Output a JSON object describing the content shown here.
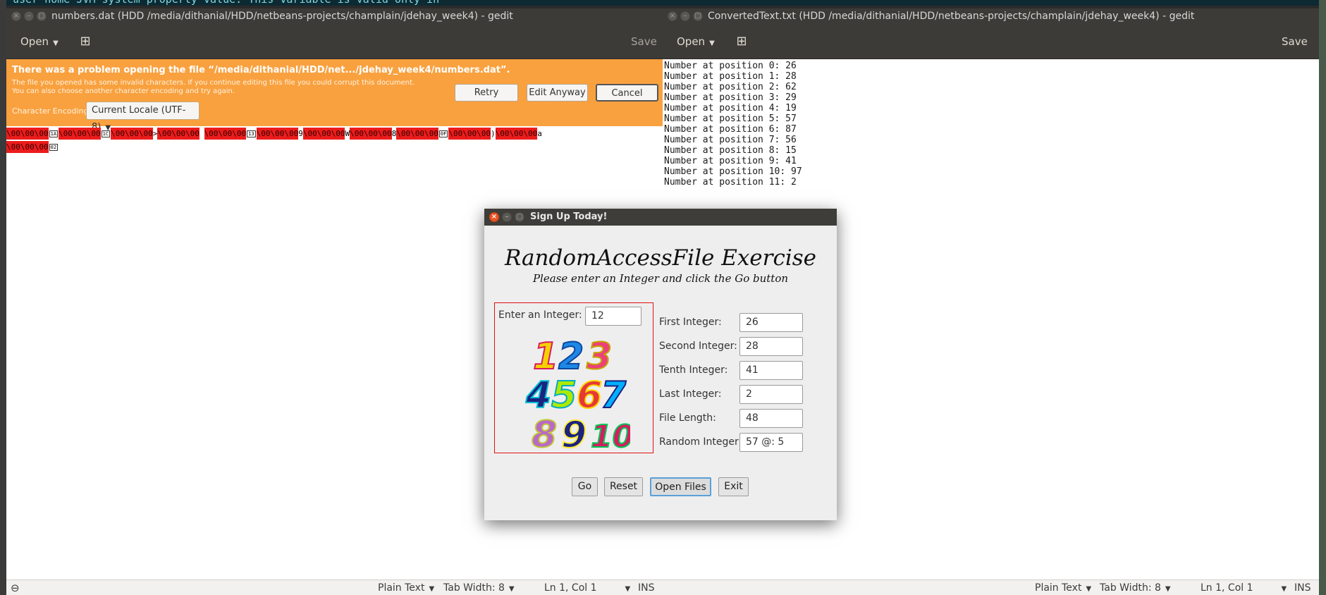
{
  "background_terminal": {
    "text": "# user home JVM system property value. This variable is valid only in"
  },
  "left_window": {
    "title": "numbers.dat (HDD /media/dithanial/HDD/netbeans-projects/champlain/jdehay_week4) - gedit",
    "toolbar": {
      "open_label": "Open",
      "new_tab_icon": "new-document-icon",
      "save_label": "Save"
    },
    "infobar": {
      "title": "There was a problem opening the file “/media/dithanial/HDD/net.../jdehay_week4/numbers.dat”.",
      "line1": "The file you opened has some invalid characters. If you continue editing this file you could corrupt this document.",
      "line2": "You can also choose another character encoding and try again.",
      "encoding_label": "Character Encoding:",
      "encoding_value": "Current Locale (UTF-8)",
      "retry_label": "Retry",
      "edit_anyway_label": "Edit Anyway",
      "cancel_label": "Cancel"
    },
    "content": {
      "line1": [
        {
          "t": "\\00\\00\\00",
          "bad": true
        },
        {
          "t": "1A",
          "box": true
        },
        {
          "t": "\\00\\00\\00",
          "bad": true
        },
        {
          "t": "1C",
          "box": true
        },
        {
          "t": "\\00\\00\\00",
          "bad": true
        },
        {
          "t": ">",
          "bad": false
        },
        {
          "t": "\\00\\00\\00",
          "bad": true
        },
        {
          "t": " ",
          "bad": false
        },
        {
          "t": "\\00\\00\\00",
          "bad": true
        },
        {
          "t": "13",
          "box": true
        },
        {
          "t": "\\00\\00\\00",
          "bad": true
        },
        {
          "t": "9",
          "bad": false
        },
        {
          "t": "\\00\\00\\00",
          "bad": true
        },
        {
          "t": "W",
          "bad": false
        },
        {
          "t": "\\00\\00\\00",
          "bad": true
        },
        {
          "t": "8",
          "bad": false
        },
        {
          "t": "\\00\\00\\00",
          "bad": true
        },
        {
          "t": "0F",
          "box": true
        },
        {
          "t": "\\00\\00\\00",
          "bad": true
        },
        {
          "t": ")",
          "bad": false
        },
        {
          "t": "\\00\\00\\00",
          "bad": true
        },
        {
          "t": "a",
          "bad": false
        }
      ],
      "line2": [
        {
          "t": "\\00\\00\\00",
          "bad": true
        },
        {
          "t": "02",
          "box": true
        }
      ]
    },
    "statusbar": {
      "syntax": "Plain Text",
      "tab_width": "Tab Width: 8",
      "position": "Ln 1, Col 1",
      "mode": "INS"
    }
  },
  "right_window": {
    "title": "ConvertedText.txt (HDD /media/dithanial/HDD/netbeans-projects/champlain/jdehay_week4) - gedit",
    "toolbar": {
      "open_label": "Open",
      "new_tab_icon": "new-document-icon",
      "save_label": "Save"
    },
    "lines": [
      "Number at position 0: 26",
      "Number at position 1: 28",
      "Number at position 2: 62",
      "Number at position 3: 29",
      "Number at position 4: 19",
      "Number at position 5: 57",
      "Number at position 6: 87",
      "Number at position 7: 56",
      "Number at position 8: 15",
      "Number at position 9: 41",
      "Number at position 10: 97",
      "Number at position 11: 2"
    ],
    "statusbar": {
      "syntax": "Plain Text",
      "tab_width": "Tab Width: 8",
      "position": "Ln 1, Col 1",
      "mode": "INS"
    }
  },
  "dialog": {
    "title": "Sign Up Today!",
    "heading": "RandomAccessFile Exercise",
    "subheading": "Please enter an Integer and click the Go button",
    "enter_label": "Enter an Integer:",
    "enter_value": "12",
    "image_rows": [
      [
        "1",
        "2",
        "3"
      ],
      [
        "4",
        "5",
        "6",
        "7"
      ],
      [
        "8",
        "9",
        "10"
      ]
    ],
    "fields": [
      {
        "label": "First Integer:",
        "value": "26"
      },
      {
        "label": "Second Integer:",
        "value": "28"
      },
      {
        "label": "Tenth Integer:",
        "value": "41"
      },
      {
        "label": "Last Integer:",
        "value": "2"
      },
      {
        "label": "File Length:",
        "value": "48"
      },
      {
        "label": "Random Integer:",
        "value": "57 @: 5"
      }
    ],
    "buttons": {
      "go": "Go",
      "reset": "Reset",
      "open_files": "Open Files",
      "exit": "Exit"
    }
  },
  "colors": {
    "infobar": "#f9a13f",
    "invalid_char_bg": "#ec1c1c",
    "panel_border": "#e01010",
    "focus_ring": "#5aa0d8"
  }
}
